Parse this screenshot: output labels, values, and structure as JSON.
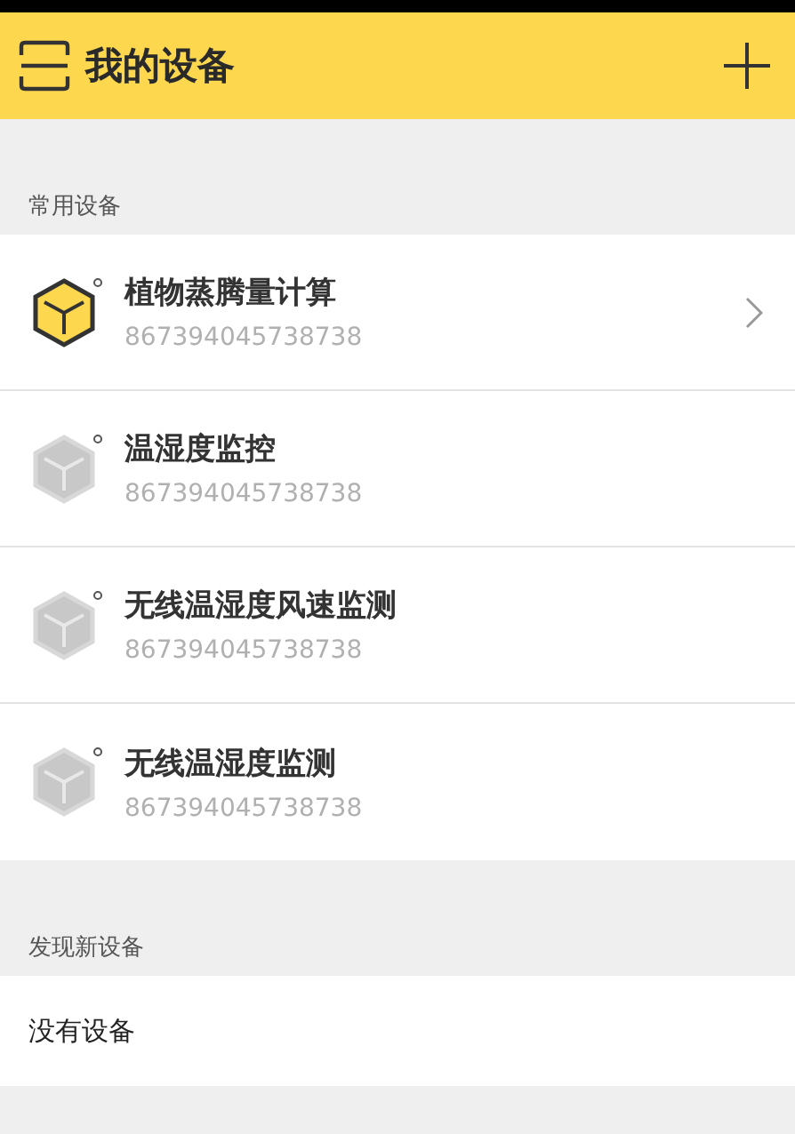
{
  "header": {
    "title": "我的设备"
  },
  "sections": [
    {
      "title": "常用设备",
      "devices": [
        {
          "name": "植物蒸腾量计算",
          "id": "867394045738738",
          "online": true
        },
        {
          "name": "温湿度监控",
          "id": "867394045738738",
          "online": false
        },
        {
          "name": "无线温湿度风速监测",
          "id": "867394045738738",
          "online": false
        },
        {
          "name": "无线温湿度监测",
          "id": "867394045738738",
          "online": false
        }
      ]
    },
    {
      "title": "发现新设备",
      "empty_text": "没有设备"
    }
  ]
}
